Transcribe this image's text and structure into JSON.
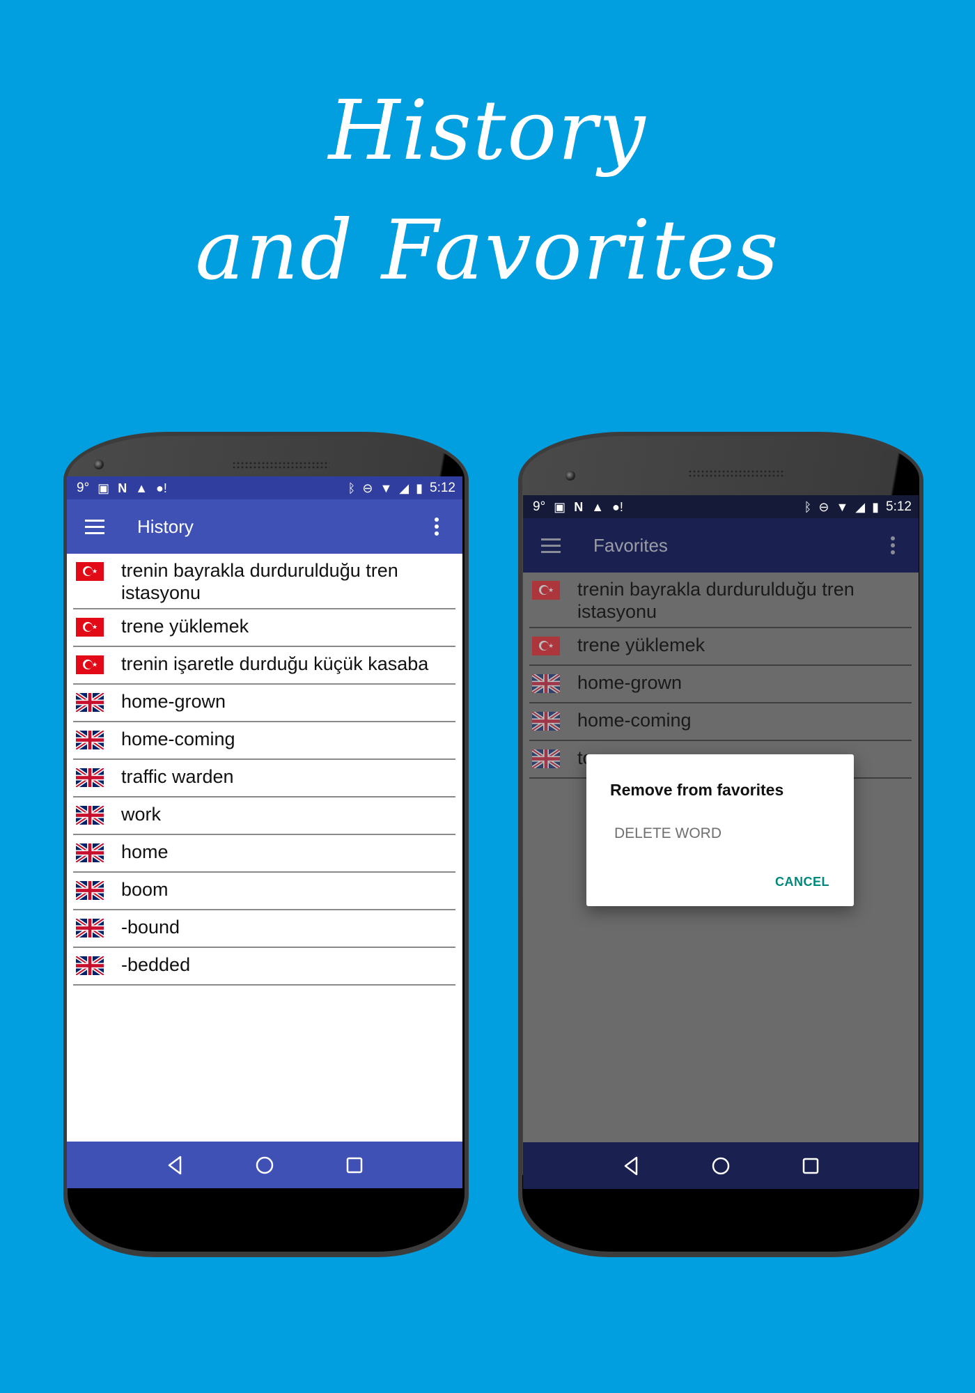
{
  "headline": {
    "line1": "History",
    "line2": "and Favorites"
  },
  "colors": {
    "background": "#029fe0",
    "history_statusbar": "#303f9f",
    "history_toolbar": "#3f51b5",
    "dialog_accent": "#00897b"
  },
  "status_bar": {
    "left_icons": [
      "9°",
      "image-icon",
      "n-icon",
      "warning-icon",
      "sync-alert-icon"
    ],
    "temperature": "9°",
    "time": "5:12",
    "right_icons": [
      "bluetooth-icon",
      "dnd-icon",
      "wifi-icon",
      "signal-icon",
      "battery-charging-icon"
    ]
  },
  "history_screen": {
    "title": "History",
    "items": [
      {
        "lang": "tr",
        "text": "trenin bayrakla durdurulduğu tren istasyonu"
      },
      {
        "lang": "tr",
        "text": "trene yüklemek"
      },
      {
        "lang": "tr",
        "text": "trenin işaretle durduğu küçük kasaba"
      },
      {
        "lang": "en",
        "text": "home-grown"
      },
      {
        "lang": "en",
        "text": "home-coming"
      },
      {
        "lang": "en",
        "text": "traffic warden"
      },
      {
        "lang": "en",
        "text": "work"
      },
      {
        "lang": "en",
        "text": "home"
      },
      {
        "lang": "en",
        "text": "boom"
      },
      {
        "lang": "en",
        "text": "-bound"
      },
      {
        "lang": "en",
        "text": "-bedded"
      }
    ]
  },
  "favorites_screen": {
    "title": "Favorites",
    "items": [
      {
        "lang": "tr",
        "text": "trenin bayrakla durdurulduğu tren istasyonu"
      },
      {
        "lang": "tr",
        "text": "trene yüklemek"
      },
      {
        "lang": "en",
        "text": "home-grown"
      },
      {
        "lang": "en",
        "text": "home-coming"
      },
      {
        "lang": "en",
        "text": "to"
      }
    ],
    "dialog": {
      "title": "Remove from favorites",
      "option": "DELETE WORD",
      "cancel": "CANCEL"
    }
  },
  "nav_bar": {
    "buttons": [
      "back-icon",
      "home-icon",
      "recents-icon"
    ]
  }
}
